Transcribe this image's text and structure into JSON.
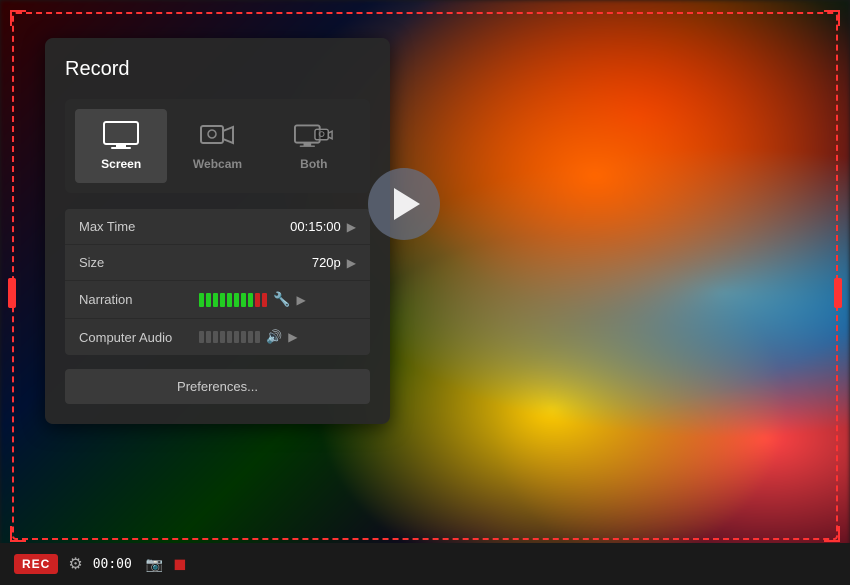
{
  "panel": {
    "title": "Record",
    "modes": [
      {
        "id": "screen",
        "label": "Screen",
        "active": true
      },
      {
        "id": "webcam",
        "label": "Webcam",
        "active": false
      },
      {
        "id": "both",
        "label": "Both",
        "active": false
      }
    ],
    "settings": [
      {
        "label": "Max Time",
        "value": "00:15:00"
      },
      {
        "label": "Size",
        "value": "720p"
      }
    ],
    "narration": {
      "label": "Narration",
      "bars_green": 8,
      "bars_red": 2
    },
    "computer_audio": {
      "label": "Computer Audio",
      "bars": 9
    },
    "preferences_label": "Preferences..."
  },
  "toolbar": {
    "rec_label": "REC",
    "time": "00:00"
  },
  "icons": {
    "play": "▶",
    "arrow_right": "▶",
    "settings": "⚙",
    "mic": "🔧",
    "speaker": "🔊"
  }
}
